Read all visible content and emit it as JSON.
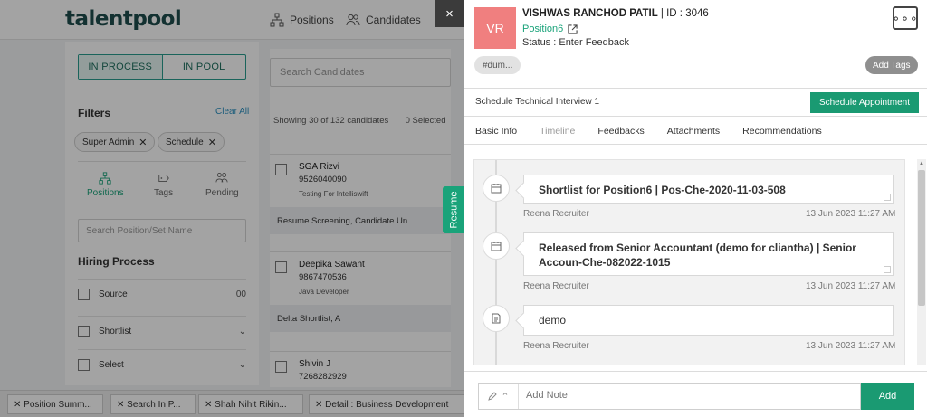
{
  "app": {
    "logo": "talentpool"
  },
  "topnav": [
    {
      "label": "Positions"
    },
    {
      "label": "Candidates"
    }
  ],
  "left": {
    "toggle": [
      "IN PROCESS",
      "IN POOL"
    ],
    "filters_title": "Filters",
    "clear_all": "Clear All",
    "chips": [
      "Super Admin",
      "Schedule"
    ],
    "nav": [
      "Positions",
      "Tags",
      "Pending"
    ],
    "search_placeholder": "Search Position/Set Name",
    "hiring_title": "Hiring Process",
    "rows": [
      {
        "label": "Source",
        "right": "00"
      },
      {
        "label": "Shortlist",
        "right": ""
      },
      {
        "label": "Select",
        "right": ""
      }
    ]
  },
  "mid": {
    "search_placeholder": "Search Candidates",
    "showing": "Showing 30 of 132 candidates",
    "selected": "0 Selected",
    "candidates": [
      {
        "name": "SGA Rizvi",
        "phone": "9526040090",
        "role": "Testing For Intelliswift",
        "stage": "Resume Screening, Candidate Un..."
      },
      {
        "name": "Deepika Sawant",
        "phone": "9867470536",
        "role": "Java Developer",
        "stage": "Delta Shortlist, A"
      },
      {
        "name": "Shivin J",
        "phone": "7268282929",
        "role": "",
        "stage": ""
      }
    ]
  },
  "resume_tab": "Resume",
  "bottom_tabs": [
    "Position Summ...",
    "Search In P...",
    "Shah Nihit Rikin...",
    "Detail : Business Development"
  ],
  "close_label": "×",
  "drawer": {
    "avatar": "VR",
    "name": "VISHWAS RANCHOD PATIL",
    "id": "ID : 3046",
    "position": "Position6",
    "status": "Status : Enter Feedback",
    "more": "∘∘∘",
    "tag": "#dum...",
    "add_tags": "Add Tags",
    "stage": "Schedule Technical Interview 1",
    "schedule_btn": "Schedule Appointment",
    "tabs": [
      "Basic Info",
      "Timeline",
      "Feedbacks",
      "Attachments",
      "Recommendations"
    ],
    "timeline": [
      {
        "text": "Shortlist for Position6 | Pos-Che-2020-11-03-508",
        "by": "Reena Recruiter",
        "time": "13 Jun 2023 11:27 AM",
        "icon": "calendar-icon"
      },
      {
        "text": "Released from Senior Accountant (demo for cliantha) | Senior Accoun-Che-082022-1015",
        "by": "Reena Recruiter",
        "time": "13 Jun 2023 11:27 AM",
        "icon": "calendar-icon"
      },
      {
        "text": "demo",
        "by": "Reena Recruiter",
        "time": "13 Jun 2023 11:27 AM",
        "icon": "document-icon"
      }
    ],
    "note_placeholder": "Add Note",
    "add_btn": "Add"
  }
}
